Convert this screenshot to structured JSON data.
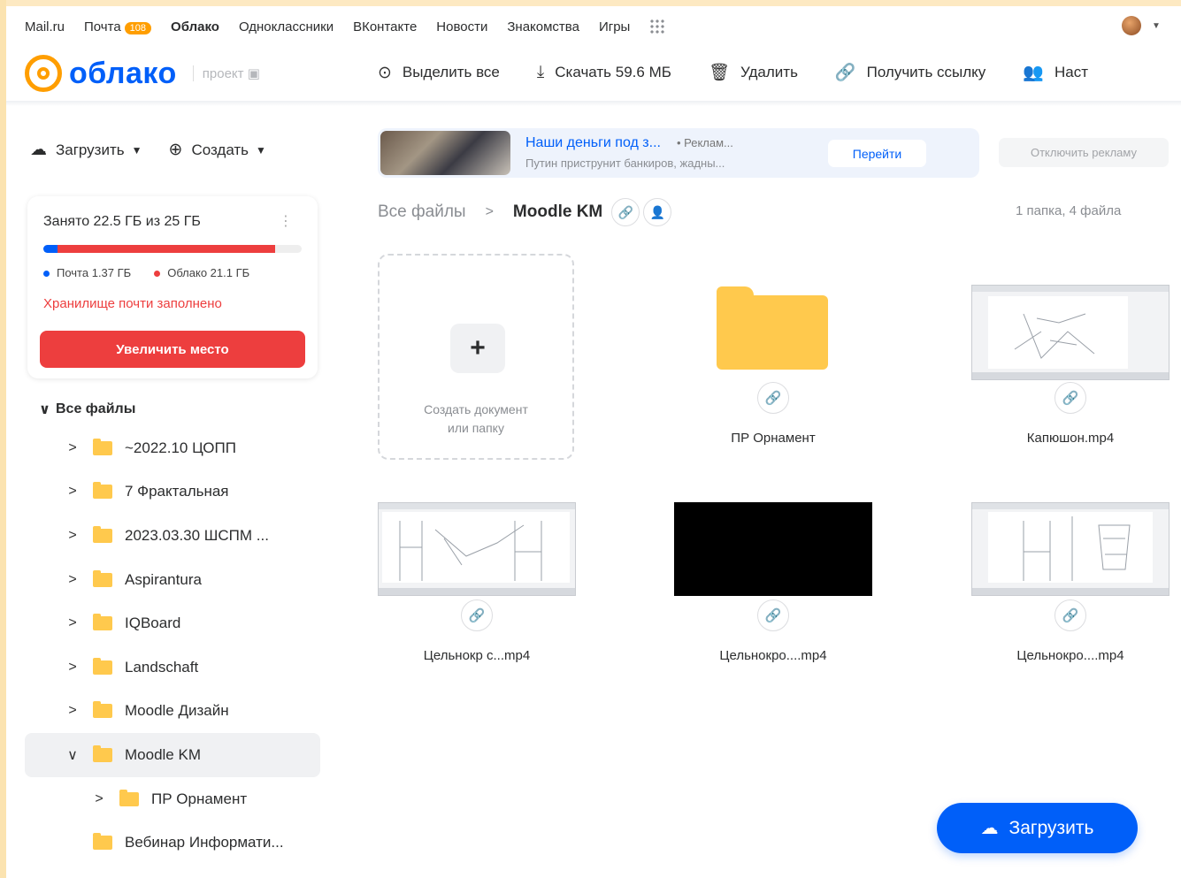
{
  "portal_nav": {
    "items": [
      "Mail.ru",
      "Почта",
      "Облако",
      "Одноклассники",
      "ВКонтакте",
      "Новости",
      "Знакомства",
      "Игры"
    ],
    "mail_badge": "108"
  },
  "header": {
    "logo_text": "облако",
    "project_label": "проект",
    "toolbar": {
      "select_all": "Выделить все",
      "download": "Скачать 59.6 МБ",
      "delete": "Удалить",
      "get_link": "Получить ссылку",
      "settings": "Наст"
    }
  },
  "sidebar": {
    "upload_label": "Загрузить",
    "create_label": "Создать",
    "storage": {
      "used_text": "Занято 22.5 ГБ из 25 ГБ",
      "mail_legend": "Почта 1.37 ГБ",
      "cloud_legend": "Облако 21.1 ГБ",
      "mail_fraction": 0.055,
      "cloud_fraction": 0.844,
      "warning": "Хранилище почти заполнено",
      "increase_button": "Увеличить место"
    },
    "tree_root": "Все файлы",
    "folders": [
      {
        "label": "~2022.10 ЦОПП"
      },
      {
        "label": "7 Фрактальная"
      },
      {
        "label": "2023.03.30 ШСПМ ..."
      },
      {
        "label": "Aspirantura"
      },
      {
        "label": "IQBoard"
      },
      {
        "label": "Landschaft"
      },
      {
        "label": "Moodle Дизайн"
      },
      {
        "label": "Moodle KM"
      },
      {
        "label": "ПР Орнамент"
      },
      {
        "label": "Вебинар Информати..."
      }
    ]
  },
  "ad": {
    "title": "Наши деньги под з...",
    "tag": "• Реклам...",
    "subtitle": "Путин приструнит банкиров, жадны...",
    "go_button": "Перейти",
    "disable_button": "Отключить рекламу"
  },
  "breadcrumb": {
    "root": "Все файлы",
    "separator": ">",
    "current": "Moodle KM",
    "count": "1 папка, 4 файла"
  },
  "create_tile": {
    "plus": "+",
    "line1": "Создать документ",
    "line2": "или папку"
  },
  "files": [
    {
      "name": "ПР Орнамент",
      "kind": "folder"
    },
    {
      "name": "Капюшон.mp4",
      "kind": "video"
    },
    {
      "name": "Цельнокр с...mp4",
      "kind": "video"
    },
    {
      "name": "Цельнокро....mp4",
      "kind": "video"
    },
    {
      "name": "Цельнокро....mp4",
      "kind": "video"
    }
  ],
  "fab": {
    "label": "Загрузить"
  },
  "colors": {
    "brand_blue": "#005ff9",
    "brand_orange": "#ff9e00",
    "alert_red": "#ed3e3e",
    "folder_yellow": "#ffc94d"
  }
}
